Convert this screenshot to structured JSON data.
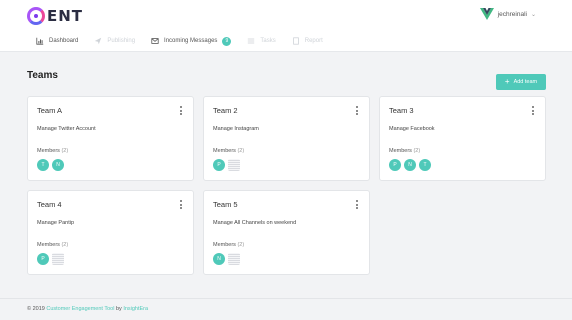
{
  "app": {
    "logo_text": "ENT",
    "logo_small": "C"
  },
  "user": {
    "name": "jechreinali"
  },
  "nav": [
    {
      "label": "Dashboard",
      "icon": "chart-icon",
      "disabled": false,
      "badge": null
    },
    {
      "label": "Publishing",
      "icon": "send-icon",
      "disabled": true,
      "badge": null
    },
    {
      "label": "Incoming Messages",
      "icon": "mail-icon",
      "disabled": false,
      "badge": "9"
    },
    {
      "label": "Tasks",
      "icon": "list-icon",
      "disabled": true,
      "badge": null
    },
    {
      "label": "Report",
      "icon": "report-icon",
      "disabled": true,
      "badge": null
    }
  ],
  "page": {
    "title": "Teams",
    "add_label": "Add team"
  },
  "teams": [
    {
      "name": "Team A",
      "desc": "Manage Twitter Account",
      "members_label": "Members",
      "count": "(2)",
      "avatars": [
        "T",
        "N"
      ],
      "has_image": false
    },
    {
      "name": "Team 2",
      "desc": "Manage Instagram",
      "members_label": "Members",
      "count": "(2)",
      "avatars": [
        "P"
      ],
      "has_image": true
    },
    {
      "name": "Team 3",
      "desc": "Manage Facebook",
      "members_label": "Members",
      "count": "(2)",
      "avatars": [
        "P",
        "N",
        "T"
      ],
      "has_image": false
    },
    {
      "name": "Team 4",
      "desc": "Manage Pantip",
      "members_label": "Members",
      "count": "(2)",
      "avatars": [
        "P"
      ],
      "has_image": true
    },
    {
      "name": "Team 5",
      "desc": "Manage All Channels on weekend",
      "members_label": "Members",
      "count": "(2)",
      "avatars": [
        "N"
      ],
      "has_image": true
    }
  ],
  "footer": {
    "prefix": "© 2019",
    "product": "Customer Engagement Tool",
    "by": "by",
    "company": "InsightEra"
  },
  "colors": {
    "accent": "#4fc9b9",
    "logo_purple": "#a855f7",
    "logo_pink": "#ec4899"
  }
}
